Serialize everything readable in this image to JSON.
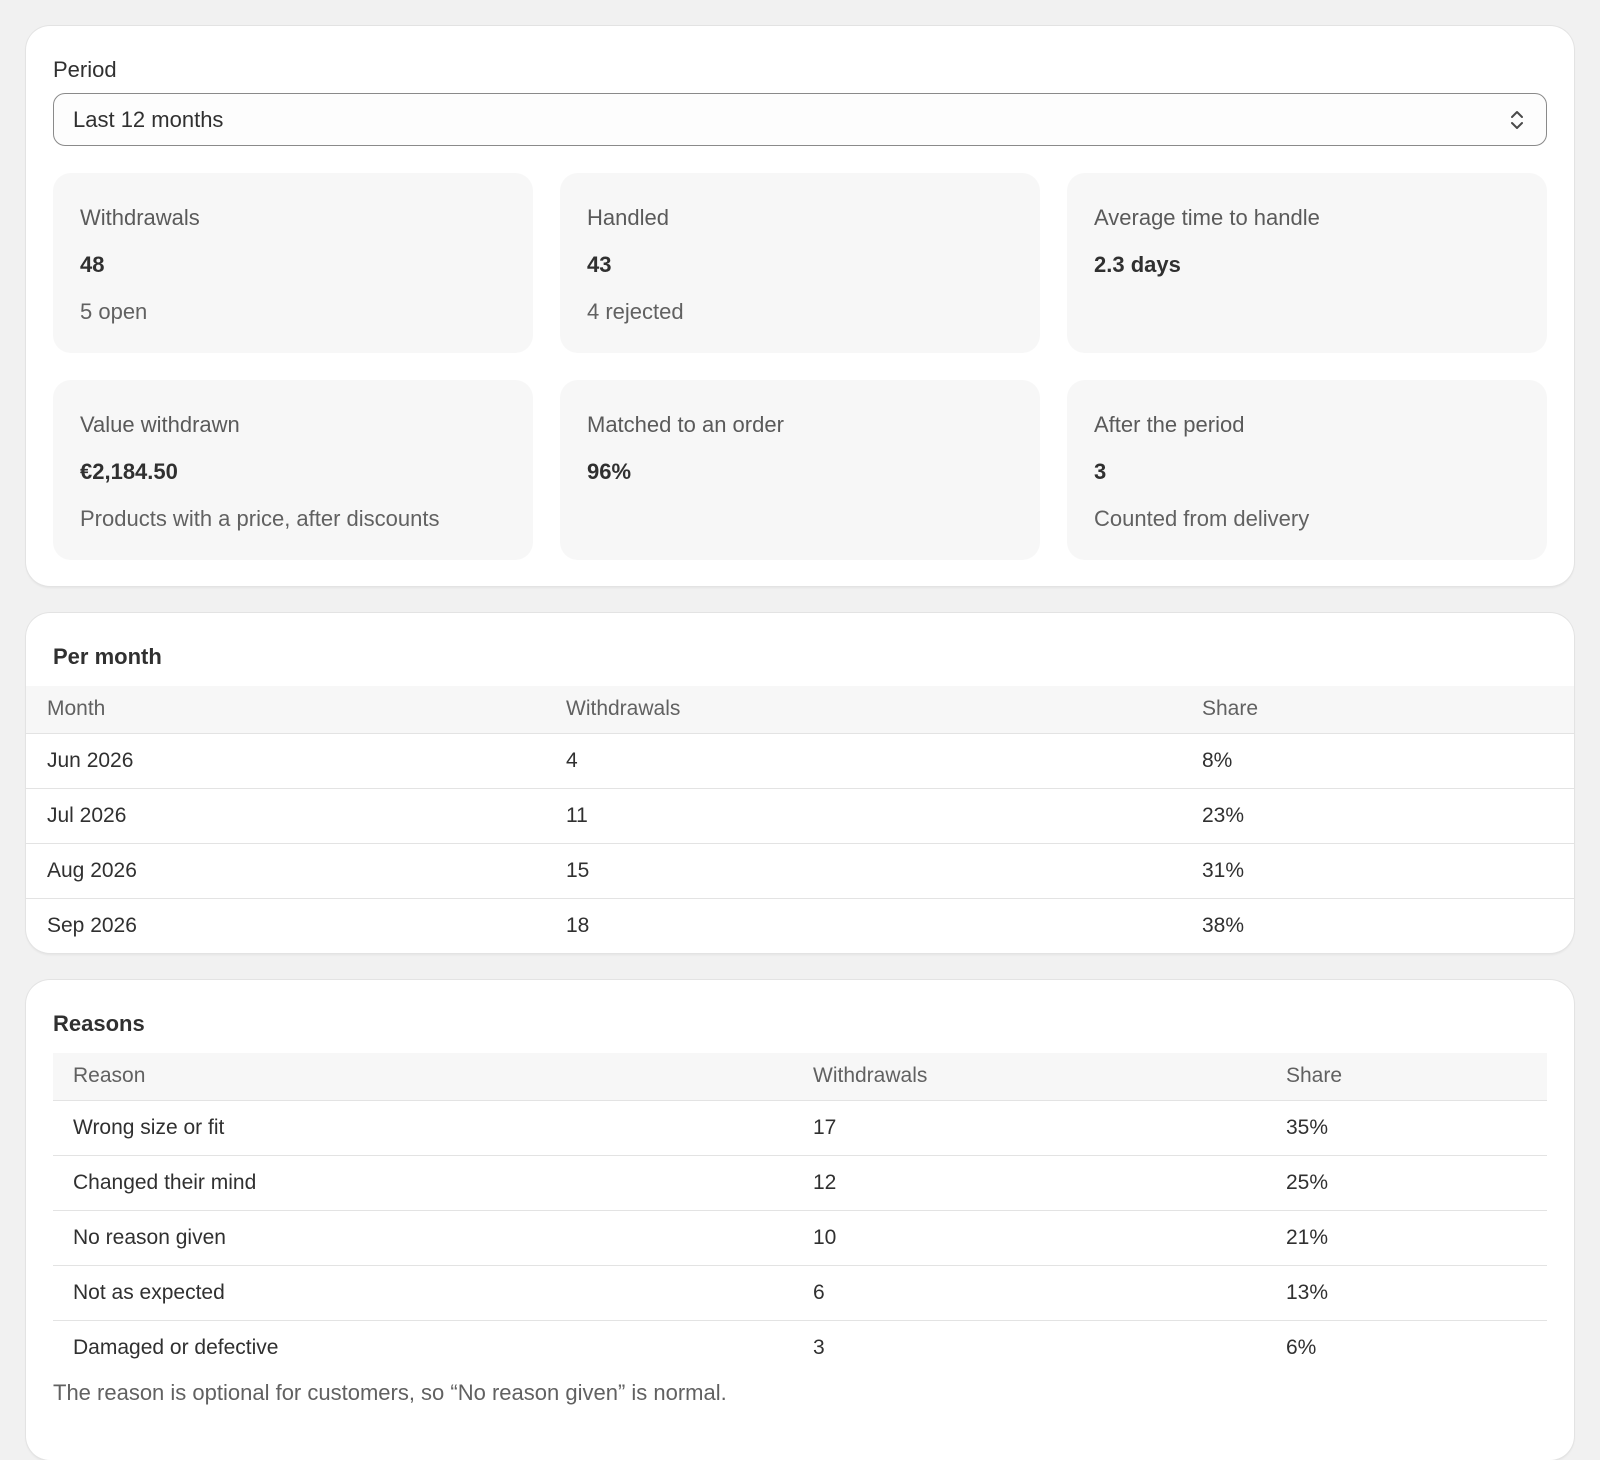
{
  "period": {
    "label": "Period",
    "selected": "Last 12 months"
  },
  "metrics": [
    {
      "label": "Withdrawals",
      "value": "48",
      "note": "5 open"
    },
    {
      "label": "Handled",
      "value": "43",
      "note": "4 rejected"
    },
    {
      "label": "Average time to handle",
      "value": "2.3 days",
      "note": ""
    },
    {
      "label": "Value withdrawn",
      "value": "€2,184.50",
      "note": "Products with a price, after discounts"
    },
    {
      "label": "Matched to an order",
      "value": "96%",
      "note": ""
    },
    {
      "label": "After the period",
      "value": "3",
      "note": "Counted from delivery"
    }
  ],
  "per_month": {
    "title": "Per month",
    "headers": [
      "Month",
      "Withdrawals",
      "Share"
    ],
    "rows": [
      [
        "Jun 2026",
        "4",
        "8%"
      ],
      [
        "Jul 2026",
        "11",
        "23%"
      ],
      [
        "Aug 2026",
        "15",
        "31%"
      ],
      [
        "Sep 2026",
        "18",
        "38%"
      ]
    ]
  },
  "reasons": {
    "title": "Reasons",
    "headers": [
      "Reason",
      "Withdrawals",
      "Share"
    ],
    "rows": [
      [
        "Wrong size or fit",
        "17",
        "35%"
      ],
      [
        "Changed their mind",
        "12",
        "25%"
      ],
      [
        "No reason given",
        "10",
        "21%"
      ],
      [
        "Not as expected",
        "6",
        "13%"
      ],
      [
        "Damaged or defective",
        "3",
        "6%"
      ]
    ],
    "footnote": "The reason is optional for customers, so “No reason given” is normal."
  }
}
